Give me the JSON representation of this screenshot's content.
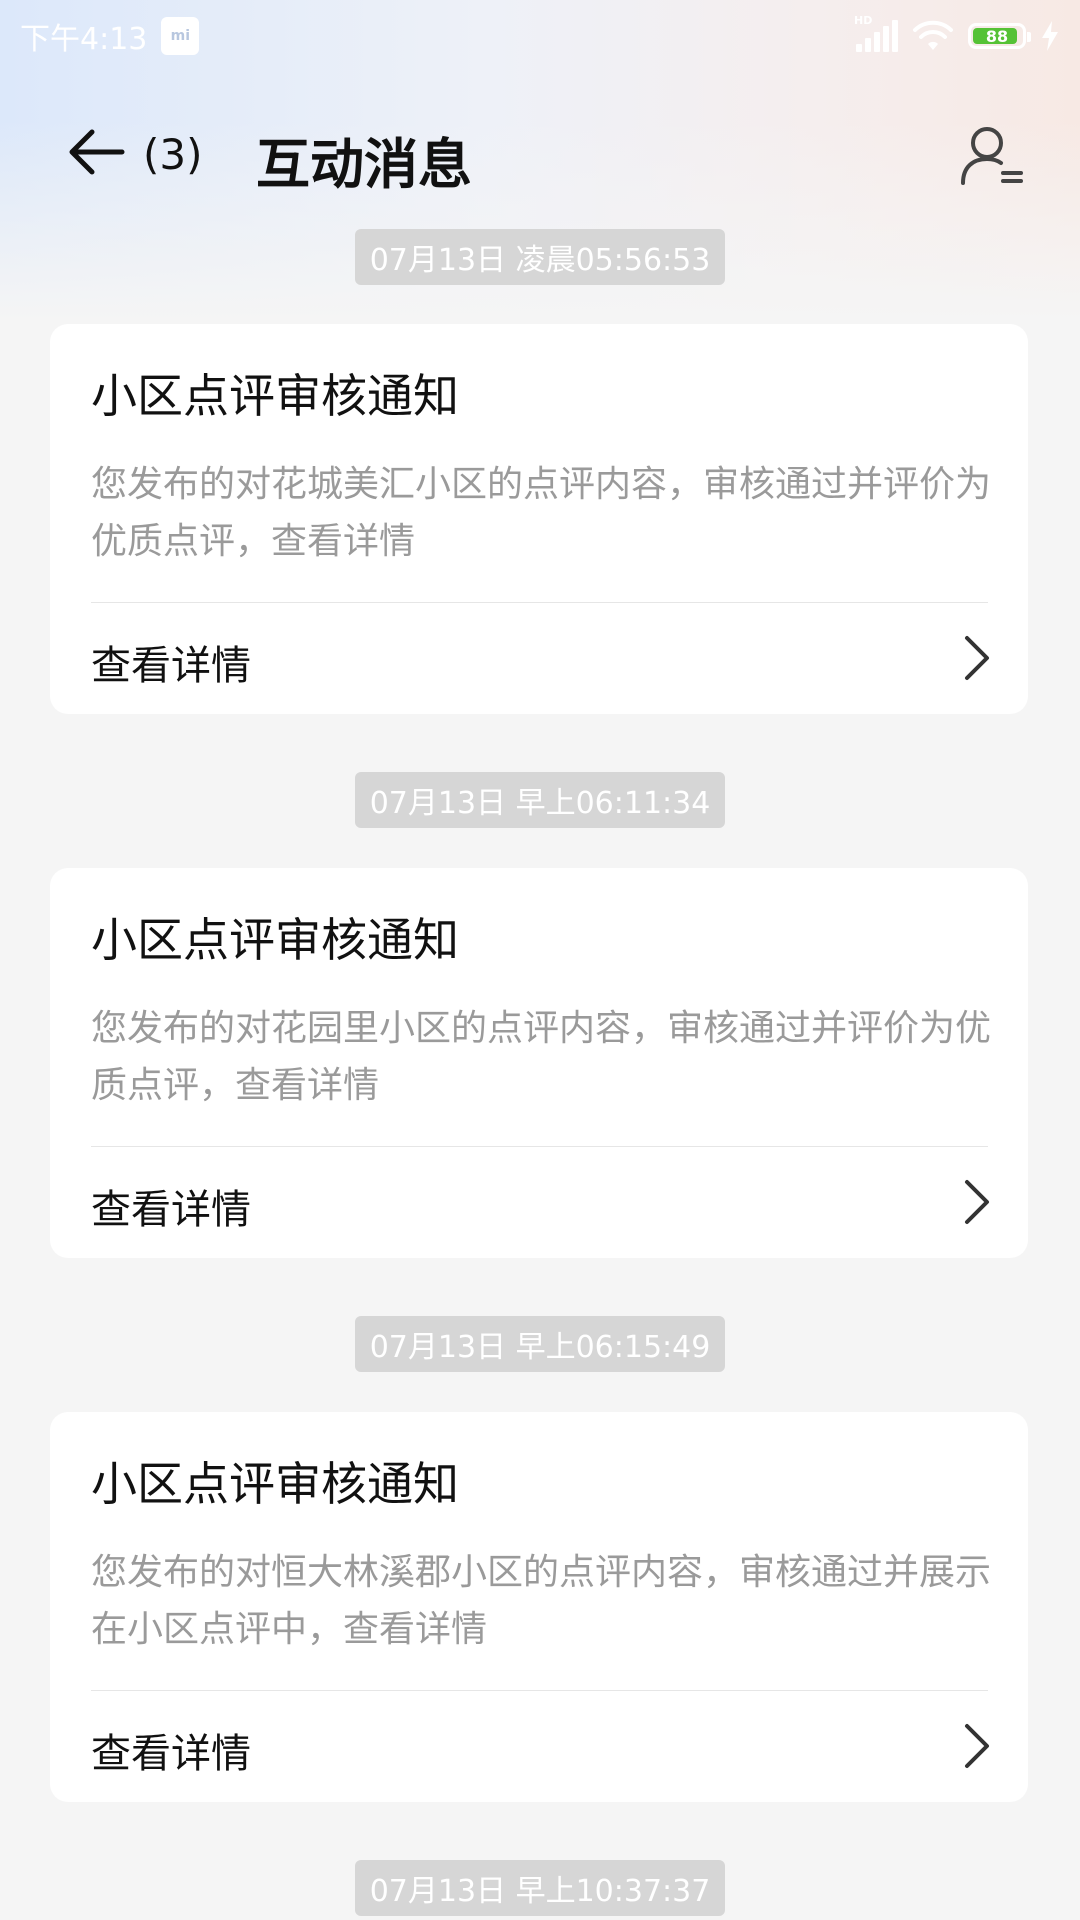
{
  "status_bar": {
    "time": "下午4:13",
    "battery_level": "88",
    "network": "HD",
    "icons": [
      "mi-icon",
      "signal-icon",
      "wifi-icon",
      "battery-icon",
      "charging-bolt-icon"
    ]
  },
  "header": {
    "back_icon": "arrow-left-icon",
    "unread_count": "(3)",
    "title": "互动消息",
    "profile_icon": "user-settings-icon"
  },
  "messages": [
    {
      "timestamp": "07月13日 凌晨05:56:53",
      "title": "小区点评审核通知",
      "body": "您发布的对花城美汇小区的点评内容，审核通过并评价为优质点评，查看详情",
      "link_label": "查看详情"
    },
    {
      "timestamp": "07月13日 早上06:11:34",
      "title": "小区点评审核通知",
      "body": "您发布的对花园里小区的点评内容，审核通过并评价为优质点评，查看详情",
      "link_label": "查看详情"
    },
    {
      "timestamp": "07月13日 早上06:15:49",
      "title": "小区点评审核通知",
      "body": "您发布的对恒大林溪郡小区的点评内容，审核通过并展示在小区点评中，查看详情",
      "link_label": "查看详情"
    },
    {
      "timestamp": "07月13日 早上10:37:37"
    }
  ],
  "colors": {
    "background": "#f5f5f5",
    "card": "#ffffff",
    "timestamp_pill": "#d6d6d6",
    "body_text": "#9a9a9a",
    "battery_green": "#55c236"
  }
}
